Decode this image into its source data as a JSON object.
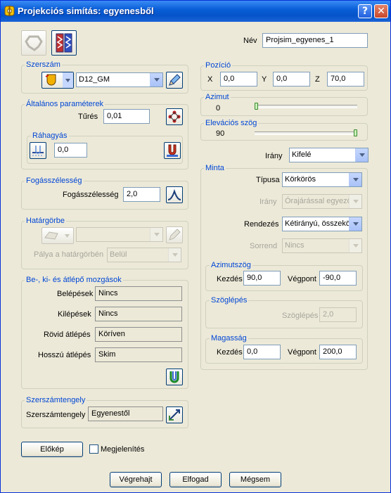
{
  "window": {
    "title": "Projekciós simítás: egyenesből",
    "help": "?",
    "close": "✕"
  },
  "name": {
    "label": "Név",
    "value": "Projsim_egyenes_1"
  },
  "tool": {
    "legend": "Szerszám",
    "value": "D12_GM"
  },
  "general": {
    "legend": "Általános paraméterek",
    "tolerance_label": "Tűrés",
    "tolerance": "0,01"
  },
  "allowance": {
    "legend": "Ráhagyás",
    "value": "0,0"
  },
  "stepover": {
    "legend": "Fogásszélesség",
    "label": "Fogásszélesség",
    "value": "2,0"
  },
  "boundary": {
    "legend": "Határgörbe",
    "path_label": "Pálya a határgörbén",
    "path_value": "Belül"
  },
  "leads": {
    "legend": "Be-, ki- és átlépő mozgások",
    "rows": [
      {
        "label": "Belépések",
        "value": "Nincs"
      },
      {
        "label": "Kilépések",
        "value": "Nincs"
      },
      {
        "label": "Rövid átlépés",
        "value": "Köríven"
      },
      {
        "label": "Hosszú átlépés",
        "value": "Skim"
      }
    ]
  },
  "toolaxis": {
    "legend": "Szerszámtengely",
    "label": "Szerszámtengely",
    "value": "Egyenestől"
  },
  "position": {
    "legend": "Pozíció",
    "x_label": "X",
    "x": "0,0",
    "y_label": "Y",
    "y": "0,0",
    "z_label": "Z",
    "z": "70,0"
  },
  "azimuth": {
    "legend": "Azimut",
    "value": "0",
    "level": 0
  },
  "elevation": {
    "legend": "Elevációs szög",
    "value": "90",
    "level": 1
  },
  "direction": {
    "label": "Irány",
    "value": "Kifelé"
  },
  "pattern": {
    "legend": "Minta",
    "type_label": "Típusa",
    "type_value": "Körkörös",
    "dir_label": "Irány",
    "dir_value": "Órajárással egyező",
    "order_label": "Rendezés",
    "order_value": "Kétirányú, összekö",
    "seq_label": "Sorrend",
    "seq_value": "Nincs",
    "azimuth_angle": {
      "legend": "Azimutszög",
      "start_label": "Kezdés",
      "start": "90,0",
      "end_label": "Végpont",
      "end": "-90,0"
    },
    "angular_step": {
      "legend": "Szöglépés",
      "label": "Szöglépés",
      "value": "2,0"
    },
    "height": {
      "legend": "Magasság",
      "start_label": "Kezdés",
      "start": "0,0",
      "end_label": "Végpont",
      "end": "200,0"
    }
  },
  "footer": {
    "preview": "Előkép",
    "display": "Megjelenítés",
    "recalc": "Végrehajt",
    "accept": "Elfogad",
    "cancel": "Mégsem"
  }
}
